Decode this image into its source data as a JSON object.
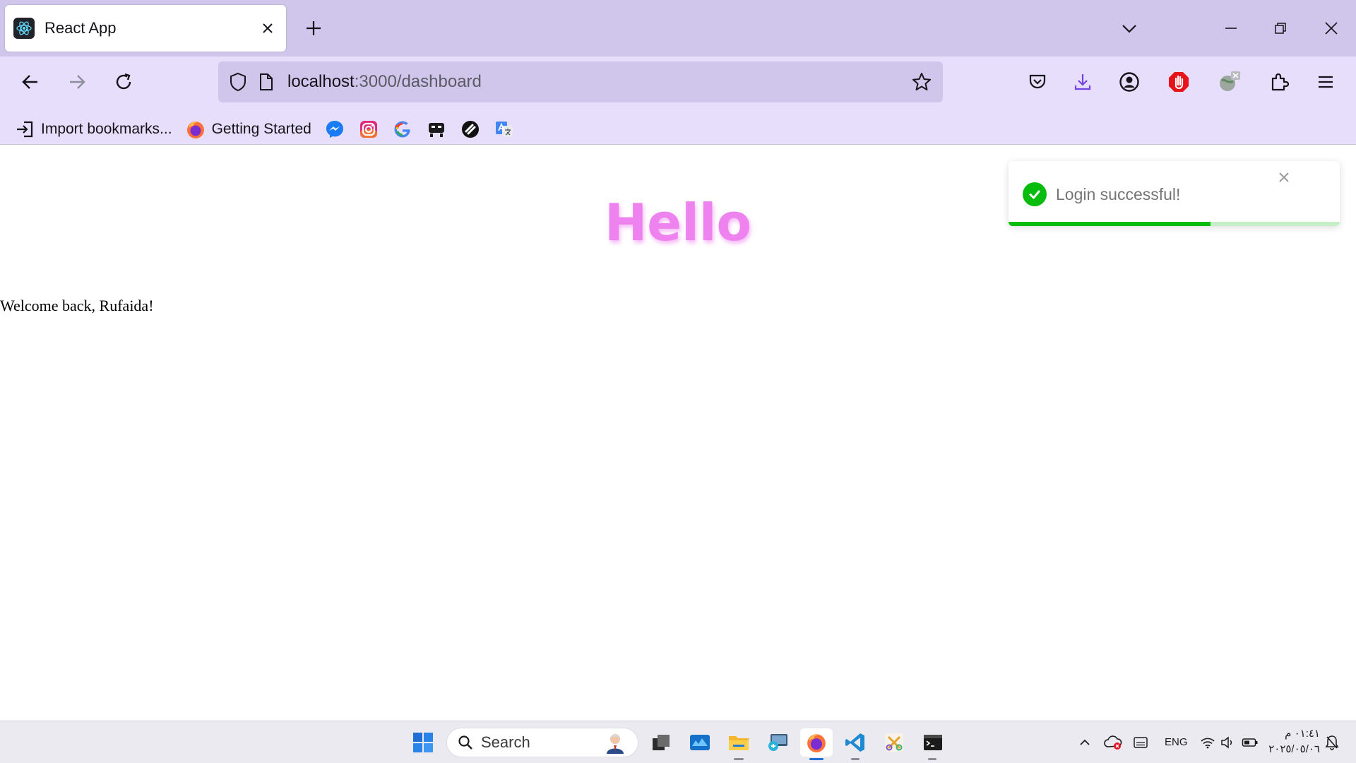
{
  "browser": {
    "tab": {
      "title": "React App",
      "favicon": "react-icon"
    },
    "url": {
      "host": "localhost",
      "path": ":3000/dashboard"
    },
    "bookmarks": [
      {
        "label": "Import bookmarks...",
        "icon": "import-icon"
      },
      {
        "label": "Getting Started",
        "icon": "firefox-icon"
      }
    ],
    "bookmark_icons": [
      "messenger-icon",
      "instagram-icon",
      "google-icon",
      "bookmark-app-icon",
      "link-app-icon",
      "translate-icon"
    ]
  },
  "page": {
    "heading": "Hello",
    "welcome_text": "Welcome back, Rufaida!"
  },
  "toast": {
    "message": "Login successful!",
    "progress": 0.61,
    "color": "#07bc0c"
  },
  "taskbar": {
    "search_placeholder": "Search",
    "language": "ENG",
    "time": "٠١:٤١ م",
    "date": "٢٠٢٥/٠٥/٠٦"
  },
  "colors": {
    "chrome_tabbar": "#d0c5ea",
    "chrome_navbar": "#e6defa",
    "heading": "#ee82ee"
  }
}
